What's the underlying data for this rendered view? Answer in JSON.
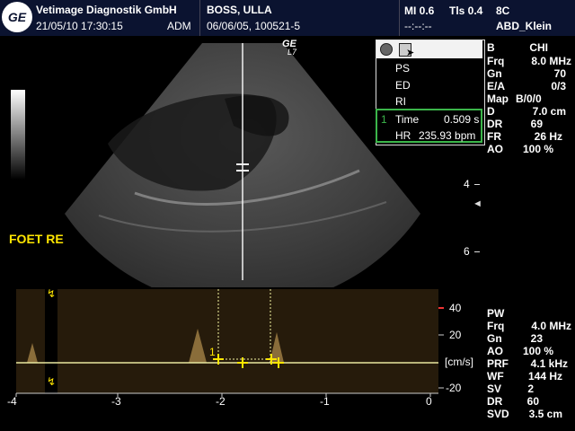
{
  "header": {
    "ge_logo_text": "GE",
    "institution": "Vetimage Diagnostik GmbH",
    "datetime": "21/05/10 17:30:15",
    "operator": "ADM",
    "patient_name": "BOSS, ULLA",
    "patient_id": "06/06/05, 100521-5",
    "mi": "MI 0.6",
    "tis": "Tls 0.4",
    "timer": "--:--:--",
    "probe": "8C",
    "preset": "ABD_Klein"
  },
  "probe_label": {
    "brand": "GE",
    "model": "L7"
  },
  "annotation": "FOET RE",
  "measure_menu": {
    "items": [
      "PS",
      "ED",
      "RI"
    ],
    "result_index": "1",
    "time_label": "Time",
    "time_value": "0.509 s",
    "hr_label": "HR",
    "hr_value": "235.93 bpm"
  },
  "depth_scale": [
    "4",
    "6"
  ],
  "b_mode_params": [
    {
      "label": "B",
      "value": "CHI"
    },
    {
      "label": "Frq",
      "value": "8.0 MHz"
    },
    {
      "label": "Gn",
      "value": "70"
    },
    {
      "label": "E/A",
      "value": "0/3"
    },
    {
      "label": "Map",
      "value": "B/0/0"
    },
    {
      "label": "D",
      "value": "7.0 cm"
    },
    {
      "label": "DR",
      "value": "69"
    },
    {
      "label": "FR",
      "value": "26 Hz"
    },
    {
      "label": "AO",
      "value": "100 %"
    }
  ],
  "pw_params": [
    {
      "label": "PW",
      "value": ""
    },
    {
      "label": "Frq",
      "value": "4.0 MHz"
    },
    {
      "label": "Gn",
      "value": "23"
    },
    {
      "label": "AO",
      "value": "100 %"
    },
    {
      "label": "PRF",
      "value": "4.1 kHz"
    },
    {
      "label": "WF",
      "value": "144 Hz"
    },
    {
      "label": "SV",
      "value": "2"
    },
    {
      "label": "DR",
      "value": "60"
    },
    {
      "label": "SVD",
      "value": "3.5 cm"
    }
  ],
  "doppler": {
    "y_ticks": [
      "40",
      "20",
      "-20"
    ],
    "unit": "[cm/s]",
    "x_ticks": [
      "-4",
      "-3",
      "-2",
      "-1",
      "0"
    ],
    "caliper_index": "1"
  },
  "colors": {
    "header_bg": "#0b1330",
    "menu_border": "#3bb54a",
    "baseline": "#e8e8a0",
    "depth_marker": "#e8e8e8"
  }
}
